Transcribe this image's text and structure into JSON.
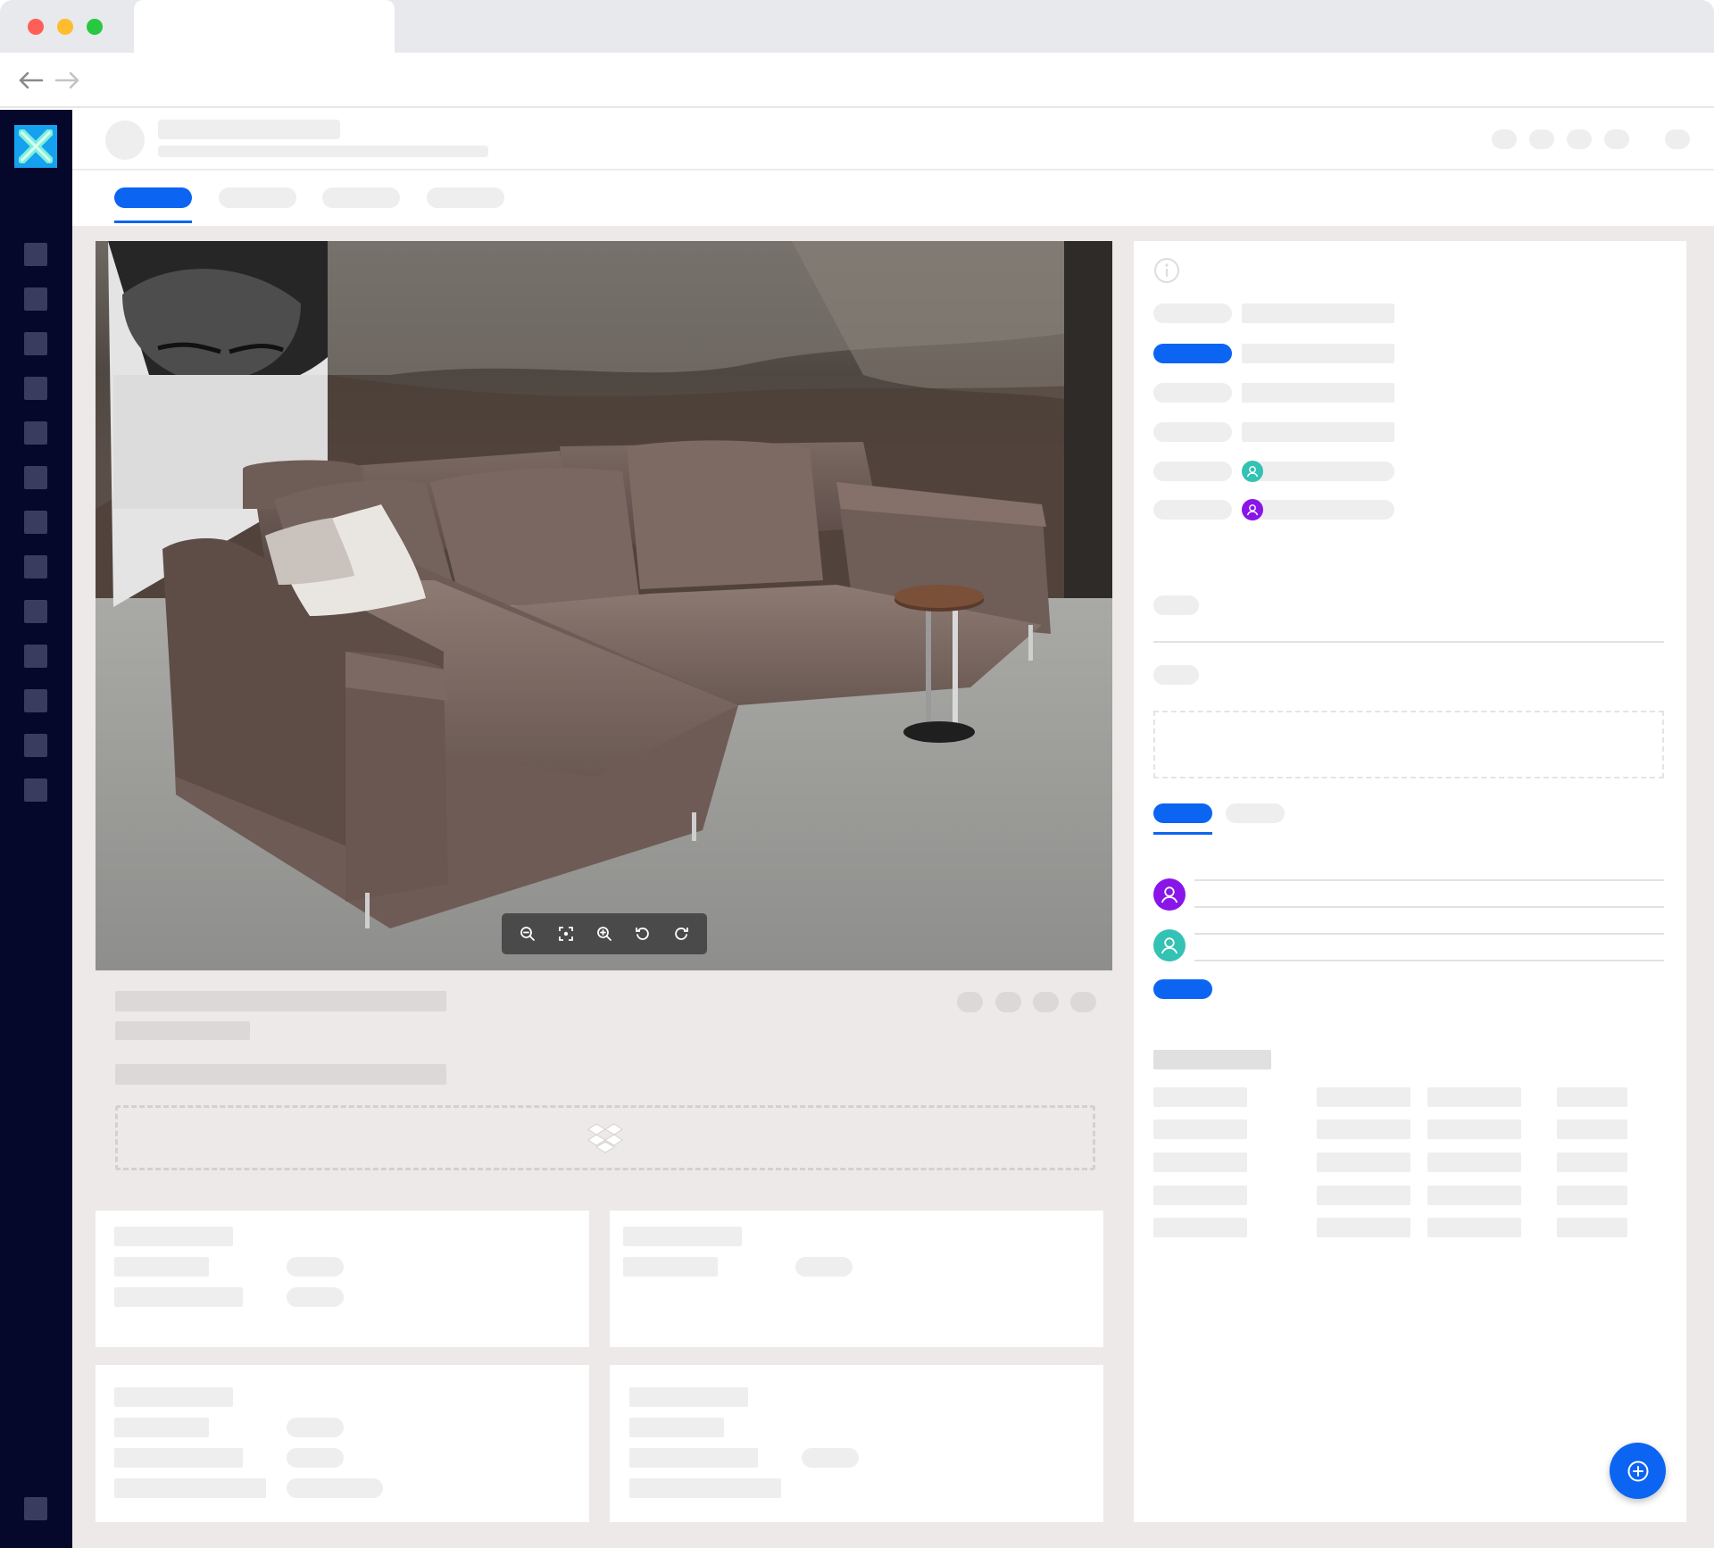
{
  "browser": {
    "traffic_lights": [
      "#ff5f57",
      "#febc2e",
      "#28c840"
    ],
    "icons": {
      "back": "arrow-left-icon",
      "forward": "arrow-right-icon"
    }
  },
  "app": {
    "brand_color": "#16a1f0",
    "accent_color": "#0c64f2",
    "sidebar_color": "#05072b",
    "logo_icon": "x-logo-icon"
  },
  "viewer": {
    "image": "sofa-photo",
    "toolbar_icons": [
      "zoom-out-icon",
      "fit-screen-icon",
      "zoom-in-icon",
      "rotate-left-icon",
      "rotate-right-icon"
    ]
  },
  "dropzone": {
    "icon": "dropbox-icon"
  },
  "details_panel": {
    "info_icon": "info-icon",
    "assignee_colors": [
      "#33c2b3",
      "#8a15e8"
    ]
  },
  "comments": {
    "avatar_colors": [
      "#8a15e8",
      "#33c2b3"
    ]
  },
  "fab": {
    "icon": "plus-circle-icon"
  }
}
